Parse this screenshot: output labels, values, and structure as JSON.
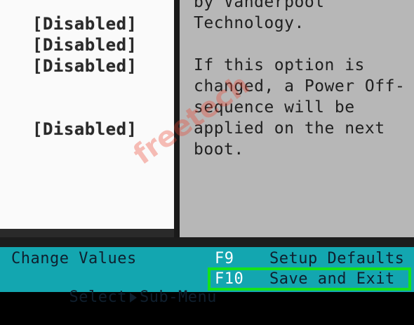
{
  "settings": {
    "values": [
      "[Disabled]",
      "[Disabled]",
      "[Disabled]",
      "[Disabled]"
    ]
  },
  "help": {
    "text": "by Vanderpool\nTechnology.\n\nIf this option is\nchanged, a Power Off-\nsequence will be\napplied on the next\nboot."
  },
  "footer": {
    "change_values": "Change Values",
    "select_prefix": "Select",
    "select_suffix": "Sub-Menu",
    "f9_key": "F9",
    "setup_defaults": "Setup Defaults",
    "f10_key": "F10",
    "save_exit": "Save and Exit"
  },
  "highlight_color": "#16e21a",
  "footer_color": "#13a6b0",
  "icons": {
    "select_arrow": "right-triangle-icon"
  },
  "watermark": "freetech"
}
